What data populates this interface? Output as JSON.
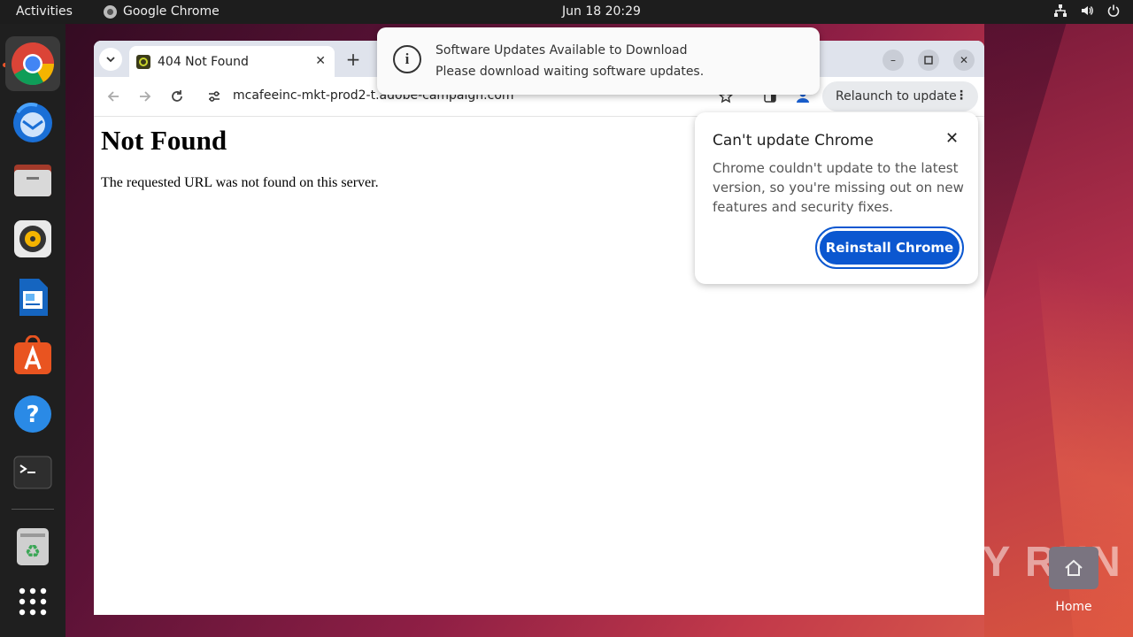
{
  "topbar": {
    "activities": "Activities",
    "app_name": "Google Chrome",
    "clock": "Jun 18  20:29"
  },
  "dock": {
    "items": [
      "chrome-icon",
      "thunderbird-icon",
      "files-icon",
      "rhythmbox-icon",
      "writer-icon",
      "app-center-icon",
      "help-icon",
      "terminal-icon",
      "trash-icon",
      "apps-grid-icon"
    ]
  },
  "browser": {
    "tab_title": "404 Not Found",
    "url": "mcafeeinc-mkt-prod2-t.adobe-campaign.com",
    "relaunch_label": "Relaunch to update"
  },
  "page": {
    "heading": "Not Found",
    "message": "The requested URL was not found on this server."
  },
  "notification": {
    "title": "Software Updates Available to Download",
    "body": "Please download waiting software updates."
  },
  "update_bubble": {
    "title": "Can't update Chrome",
    "body": "Chrome couldn't update to the latest version, so you're missing out on new features and security fixes.",
    "button": "Reinstall Chrome"
  },
  "desktop": {
    "home_label": "Home"
  },
  "watermark": "ANY RUN",
  "colors": {
    "accent_blue": "#0b57d0",
    "dock_bg": "#1f1f1f",
    "topbar_bg": "#1d1d1d"
  }
}
